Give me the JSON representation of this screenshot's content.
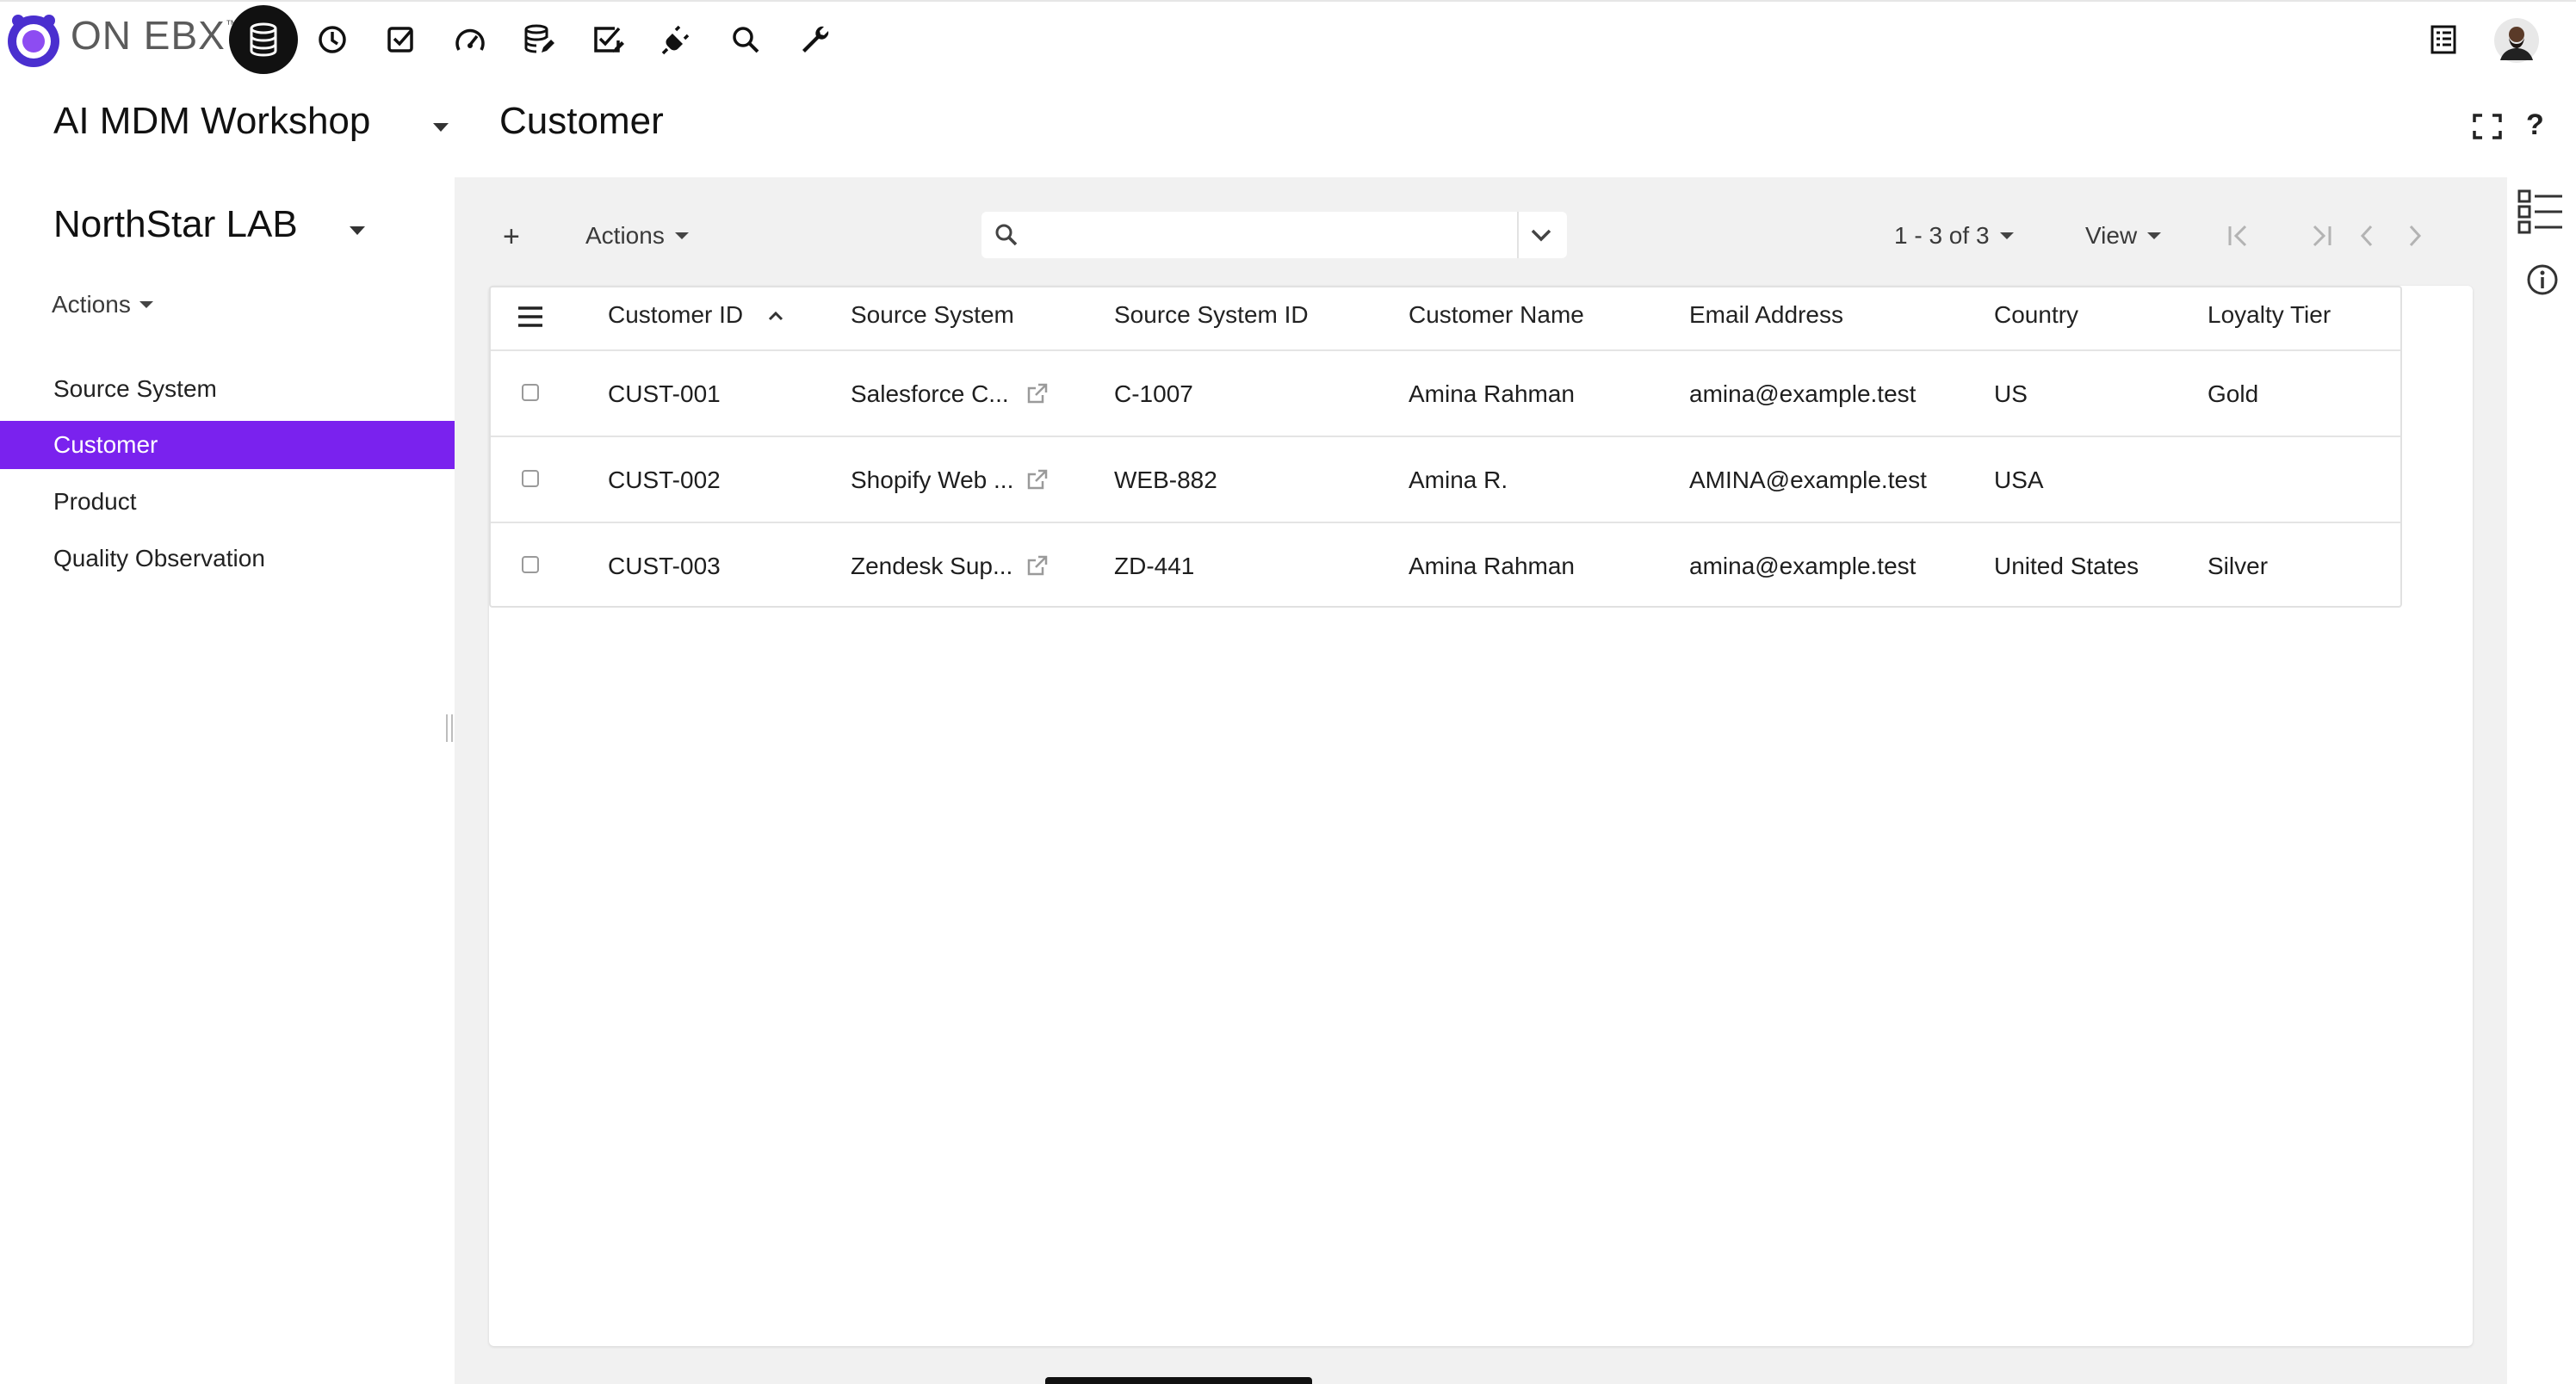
{
  "brand": {
    "name": "ON EBX",
    "tm": "™"
  },
  "toolbar": {
    "icons": [
      "data-icon",
      "clock-icon",
      "task-check-icon",
      "dashboard-gauge-icon",
      "database-edit-icon",
      "approval-check-icon",
      "plug-icon",
      "search-icon",
      "wrench-icon"
    ],
    "right_icons": [
      "task-list-icon",
      "avatar"
    ]
  },
  "project": {
    "title": "AI MDM Workshop"
  },
  "dataspace": {
    "title": "NorthStar LAB",
    "actions_label": "Actions"
  },
  "page": {
    "title": "Customer"
  },
  "sidebar": {
    "items": [
      {
        "label": "Source System",
        "active": false
      },
      {
        "label": "Customer",
        "active": true
      },
      {
        "label": "Product",
        "active": false
      },
      {
        "label": "Quality Observation",
        "active": false
      }
    ]
  },
  "table_toolbar": {
    "add_label": "+",
    "actions_label": "Actions",
    "search_placeholder": "",
    "search_value": "",
    "pagination_label": "1 - 3 of 3",
    "view_label": "View"
  },
  "table": {
    "columns": [
      "Customer ID",
      "Source System",
      "Source System ID",
      "Customer Name",
      "Email Address",
      "Country",
      "Loyalty Tier"
    ],
    "rows": [
      {
        "customer_id": "CUST-001",
        "source_system": "Salesforce C...",
        "source_system_id": "C-1007",
        "customer_name": "Amina Rahman",
        "email": "amina@example.test",
        "country": "US",
        "loyalty_tier": "Gold"
      },
      {
        "customer_id": "CUST-002",
        "source_system": "Shopify Web ...",
        "source_system_id": "WEB-882",
        "customer_name": "Amina R.",
        "email": "AMINA@example.test",
        "country": "USA",
        "loyalty_tier": ""
      },
      {
        "customer_id": "CUST-003",
        "source_system": "Zendesk Sup...",
        "source_system_id": "ZD-441",
        "customer_name": "Amina Rahman",
        "email": "amina@example.test",
        "country": "United States",
        "loyalty_tier": "Silver"
      }
    ]
  },
  "colors": {
    "accent": "#7a22ee",
    "panel_bg": "#f1f1f1"
  }
}
